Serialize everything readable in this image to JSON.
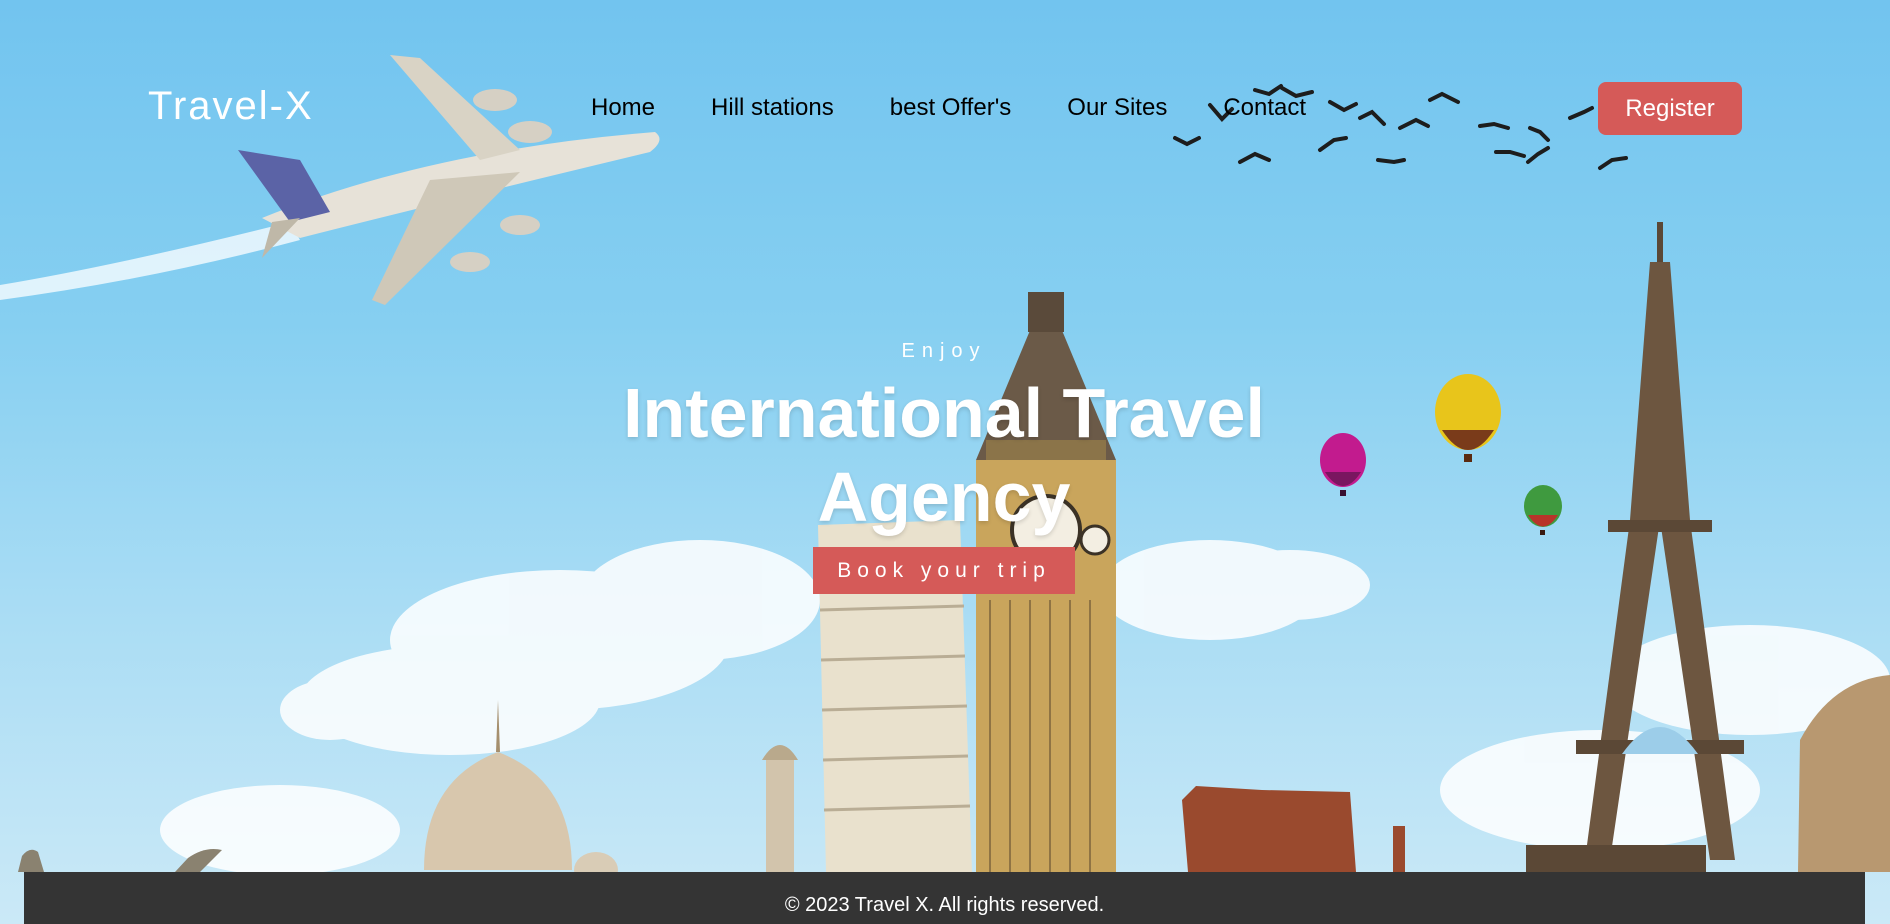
{
  "nav": {
    "logo": "Travel-X",
    "links": [
      "Home",
      "Hill stations",
      "best Offer's",
      "Our Sites",
      "Contact"
    ],
    "register_label": "Register"
  },
  "hero": {
    "kicker": "Enjoy",
    "headline": "International Travel Agency",
    "cta_label": "Book your trip"
  },
  "footer": {
    "copyright": "© 2023 Travel X. All rights reserved."
  },
  "colors": {
    "accent": "#d55a58",
    "footer_bg": "#343434",
    "sky": "#7cc8ee"
  }
}
